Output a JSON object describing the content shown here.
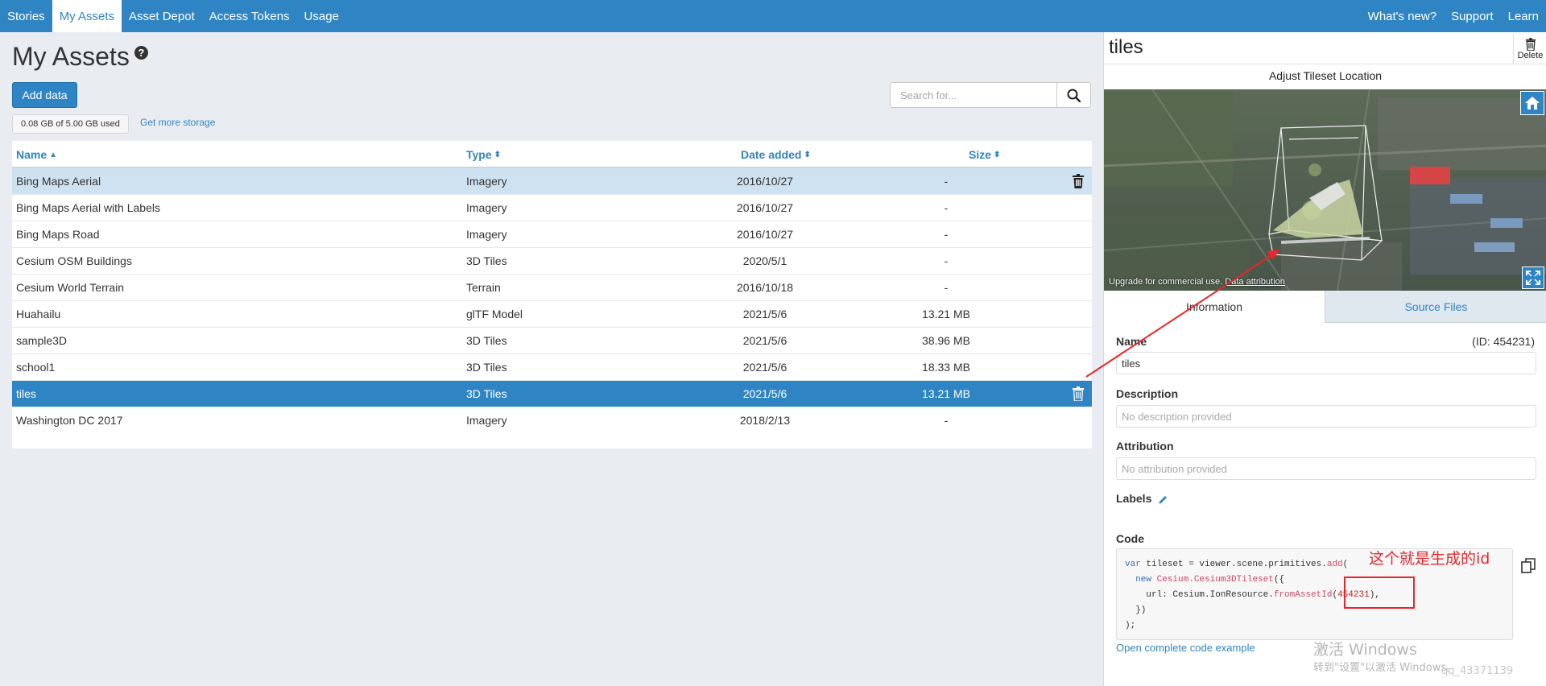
{
  "nav": {
    "left": [
      "Stories",
      "My Assets",
      "Asset Depot",
      "Access Tokens",
      "Usage"
    ],
    "right": [
      "What's new?",
      "Support",
      "Learn"
    ],
    "active": "My Assets"
  },
  "page": {
    "title": "My Assets",
    "help_icon": "question-circle-icon",
    "add_data_label": "Add data",
    "storage_used": "0.08 GB of 5.00 GB used",
    "more_storage_label": "Get more storage",
    "search_placeholder": "Search for...",
    "search_icon": "magnifier-icon"
  },
  "table": {
    "columns": [
      "Name",
      "Type",
      "Date added",
      "Size"
    ],
    "sort_column": "Name",
    "sort_direction": "ascending",
    "rows": [
      {
        "name": "Bing Maps Aerial",
        "type": "Imagery",
        "date": "2016/10/27",
        "size": "-"
      },
      {
        "name": "Bing Maps Aerial with Labels",
        "type": "Imagery",
        "date": "2016/10/27",
        "size": "-"
      },
      {
        "name": "Bing Maps Road",
        "type": "Imagery",
        "date": "2016/10/27",
        "size": "-"
      },
      {
        "name": "Cesium OSM Buildings",
        "type": "3D Tiles",
        "date": "2020/5/1",
        "size": "-"
      },
      {
        "name": "Cesium World Terrain",
        "type": "Terrain",
        "date": "2016/10/18",
        "size": "-"
      },
      {
        "name": "Huahailu",
        "type": "glTF Model",
        "date": "2021/5/6",
        "size": "13.21 MB"
      },
      {
        "name": "sample3D",
        "type": "3D Tiles",
        "date": "2021/5/6",
        "size": "38.96 MB"
      },
      {
        "name": "school1",
        "type": "3D Tiles",
        "date": "2021/5/6",
        "size": "18.33 MB"
      },
      {
        "name": "tiles",
        "type": "3D Tiles",
        "date": "2021/5/6",
        "size": "13.21 MB"
      },
      {
        "name": "Washington DC 2017",
        "type": "Imagery",
        "date": "2018/2/13",
        "size": "-"
      }
    ],
    "hover_row": 0,
    "selected_row": 8
  },
  "details": {
    "title": "tiles",
    "delete_label": "Delete",
    "adjust_label": "Adjust Tileset Location",
    "attribution_prefix": "Upgrade for commercial use.",
    "attribution_link": "Data attribution",
    "tabs": [
      "Information",
      "Source Files"
    ],
    "active_tab": "Information",
    "name_label": "Name",
    "id_text": "(ID:   454231)",
    "name_value": "tiles",
    "description_label": "Description",
    "description_placeholder": "No description provided",
    "attribution_label": "Attribution",
    "attribution_placeholder": "No attribution provided",
    "labels_label": "Labels",
    "code_label": "Code",
    "code_asset_id": "454231",
    "code_link": "Open complete code example"
  },
  "annotation": {
    "text": "这个就是生成的id",
    "color": "#e8262b"
  },
  "watermark": {
    "line1": "激活 Windows",
    "line2": "转到\"设置\"以激活 Windows。",
    "line3": "qq_43371139"
  },
  "colors": {
    "accent": "#2f85c3",
    "selected_row": "#2f85c3",
    "hover_row": "#cfe2f1",
    "annotation": "#e8262b"
  }
}
